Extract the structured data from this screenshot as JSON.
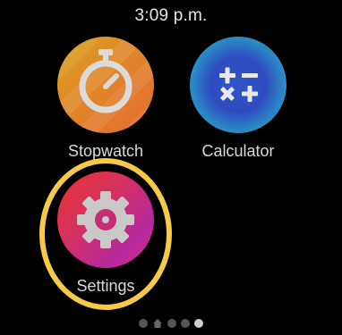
{
  "status_bar": {
    "time": "3:09 p.m."
  },
  "apps": [
    {
      "label": "Stopwatch",
      "icon": "stopwatch-icon",
      "color": "#e0882a"
    },
    {
      "label": "Calculator",
      "icon": "calculator-icon",
      "color": "#2e4cc0"
    },
    {
      "label": "Settings",
      "icon": "gear-icon",
      "color": "#d2306a"
    }
  ],
  "highlight": {
    "target": "Settings",
    "color": "#f7c948"
  },
  "pager": {
    "pages": 5,
    "home_index": 1,
    "active_index": 4
  }
}
